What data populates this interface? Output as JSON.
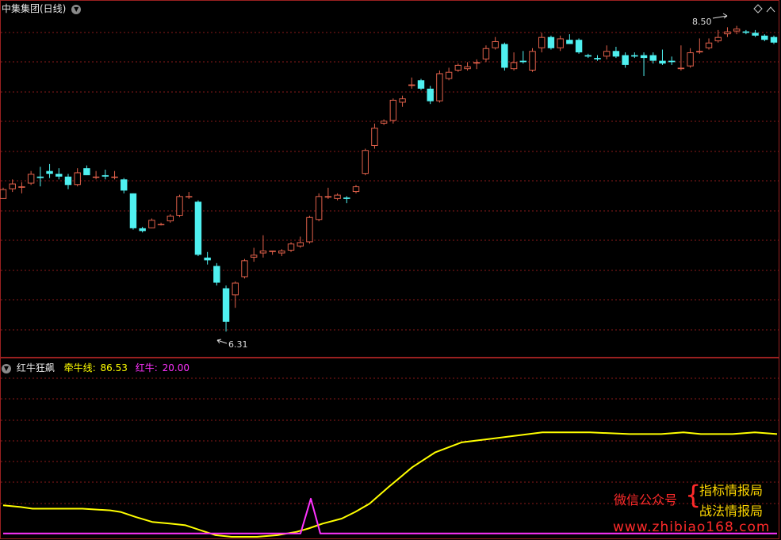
{
  "upper_header": {
    "title": "中集集团(日线)",
    "icon": "chevron-down-icon"
  },
  "upper_chart": {
    "high_label": "8.50",
    "low_label": "6.31"
  },
  "lower_header": {
    "name": "红牛狂飙",
    "line1_label": "牵牛线:",
    "line1_value": "86.53",
    "line2_label": "红牛:",
    "line2_value": "20.00"
  },
  "watermark": {
    "left": "微信公众号",
    "brace": "{",
    "right_top": "指标情报局",
    "right_bottom": "战法情报局",
    "url": "www.zhibiao168.com"
  },
  "colors": {
    "background": "#000000",
    "up": "#e0604a",
    "down": "#4ff0f0",
    "grid": "#8a1a1a",
    "border": "#9a2020",
    "line1": "#ffff00",
    "line2": "#ff33ff",
    "watermark_red": "#ff2a2a",
    "watermark_yellow": "#ffd800"
  },
  "chart_data": [
    {
      "type": "candlestick",
      "title": "中集集团(日线)",
      "annotations": [
        {
          "text": "8.50",
          "at": "high"
        },
        {
          "text": "6.31",
          "at": "low"
        }
      ],
      "ylim": [
        6.2,
        8.62
      ],
      "candles": [
        [
          7.28,
          7.36,
          7.28,
          7.35
        ],
        [
          7.35,
          7.42,
          7.33,
          7.39
        ],
        [
          7.36,
          7.4,
          7.32,
          7.37
        ],
        [
          7.39,
          7.48,
          7.38,
          7.46
        ],
        [
          7.44,
          7.51,
          7.37,
          7.43
        ],
        [
          7.48,
          7.53,
          7.43,
          7.46
        ],
        [
          7.46,
          7.5,
          7.42,
          7.44
        ],
        [
          7.44,
          7.46,
          7.35,
          7.38
        ],
        [
          7.38,
          7.5,
          7.37,
          7.47
        ],
        [
          7.5,
          7.52,
          7.45,
          7.45
        ],
        [
          7.44,
          7.48,
          7.42,
          7.44
        ],
        [
          7.45,
          7.49,
          7.42,
          7.44
        ],
        [
          7.44,
          7.48,
          7.42,
          7.44
        ],
        [
          7.42,
          7.43,
          7.32,
          7.34
        ],
        [
          7.32,
          7.32,
          7.06,
          7.07
        ],
        [
          7.07,
          7.08,
          7.04,
          7.05
        ],
        [
          7.07,
          7.14,
          7.07,
          7.13
        ],
        [
          7.1,
          7.11,
          7.09,
          7.1
        ],
        [
          7.12,
          7.17,
          7.11,
          7.16
        ],
        [
          7.16,
          7.31,
          7.15,
          7.3
        ],
        [
          7.3,
          7.33,
          7.28,
          7.3
        ],
        [
          7.26,
          7.27,
          6.87,
          6.88
        ],
        [
          6.86,
          6.9,
          6.81,
          6.84
        ],
        [
          6.8,
          6.82,
          6.66,
          6.68
        ],
        [
          6.64,
          6.66,
          6.33,
          6.4
        ],
        [
          6.59,
          6.69,
          6.5,
          6.68
        ],
        [
          6.72,
          6.85,
          6.71,
          6.84
        ],
        [
          6.86,
          6.93,
          6.83,
          6.88
        ],
        [
          6.89,
          7.02,
          6.86,
          6.91
        ],
        [
          6.9,
          6.91,
          6.88,
          6.91
        ],
        [
          6.89,
          6.92,
          6.87,
          6.91
        ],
        [
          6.91,
          6.97,
          6.9,
          6.96
        ],
        [
          6.94,
          7.01,
          6.93,
          6.97
        ],
        [
          6.97,
          7.16,
          6.96,
          7.15
        ],
        [
          7.13,
          7.32,
          7.12,
          7.3
        ],
        [
          7.29,
          7.36,
          7.28,
          7.3
        ],
        [
          7.28,
          7.32,
          7.27,
          7.31
        ],
        [
          7.29,
          7.3,
          7.25,
          7.28
        ],
        [
          7.33,
          7.38,
          7.32,
          7.37
        ],
        [
          7.46,
          7.64,
          7.45,
          7.63
        ],
        [
          7.66,
          7.82,
          7.64,
          7.79
        ],
        [
          7.82,
          7.85,
          7.81,
          7.84
        ],
        [
          7.84,
          8.0,
          7.82,
          7.99
        ],
        [
          7.97,
          8.02,
          7.94,
          8.0
        ],
        [
          8.09,
          8.15,
          8.07,
          8.1
        ],
        [
          8.13,
          8.14,
          8.06,
          8.07
        ],
        [
          8.07,
          8.09,
          7.96,
          7.98
        ],
        [
          7.98,
          8.2,
          7.97,
          8.18
        ],
        [
          8.14,
          8.22,
          8.13,
          8.19
        ],
        [
          8.2,
          8.25,
          8.19,
          8.24
        ],
        [
          8.21,
          8.26,
          8.2,
          8.23
        ],
        [
          8.25,
          8.28,
          8.21,
          8.26
        ],
        [
          8.28,
          8.38,
          8.26,
          8.36
        ],
        [
          8.36,
          8.44,
          8.35,
          8.41
        ],
        [
          8.39,
          8.4,
          8.2,
          8.22
        ],
        [
          8.21,
          8.33,
          8.2,
          8.26
        ],
        [
          8.27,
          8.34,
          8.25,
          8.26
        ],
        [
          8.2,
          8.36,
          8.19,
          8.34
        ],
        [
          8.36,
          8.47,
          8.33,
          8.44
        ],
        [
          8.44,
          8.45,
          8.35,
          8.36
        ],
        [
          8.36,
          8.45,
          8.34,
          8.43
        ],
        [
          8.42,
          8.46,
          8.39,
          8.39
        ],
        [
          8.42,
          8.43,
          8.32,
          8.33
        ],
        [
          8.31,
          8.32,
          8.29,
          8.3
        ],
        [
          8.29,
          8.31,
          8.27,
          8.28
        ],
        [
          8.3,
          8.38,
          8.28,
          8.34
        ],
        [
          8.34,
          8.37,
          8.29,
          8.3
        ],
        [
          8.31,
          8.33,
          8.22,
          8.24
        ],
        [
          8.31,
          8.33,
          8.29,
          8.3
        ],
        [
          8.31,
          8.33,
          8.16,
          8.29
        ],
        [
          8.31,
          8.33,
          8.25,
          8.27
        ],
        [
          8.27,
          8.35,
          8.24,
          8.25
        ],
        [
          8.27,
          8.3,
          8.24,
          8.26
        ],
        [
          8.21,
          8.38,
          8.2,
          8.22
        ],
        [
          8.23,
          8.36,
          8.22,
          8.33
        ],
        [
          8.33,
          8.43,
          8.32,
          8.34
        ],
        [
          8.36,
          8.43,
          8.35,
          8.4
        ],
        [
          8.41,
          8.49,
          8.4,
          8.44
        ],
        [
          8.46,
          8.51,
          8.44,
          8.48
        ],
        [
          8.48,
          8.52,
          8.46,
          8.5
        ],
        [
          8.48,
          8.49,
          8.46,
          8.47
        ],
        [
          8.47,
          8.49,
          8.44,
          8.45
        ],
        [
          8.45,
          8.46,
          8.41,
          8.42
        ],
        [
          8.44,
          8.45,
          8.39,
          8.4
        ]
      ]
    },
    {
      "type": "line",
      "title": "红牛狂飙",
      "ylim": [
        0,
        100
      ],
      "series": [
        {
          "name": "牵牛线",
          "last": 86.53,
          "x": [
            0,
            22,
            37,
            62,
            81,
            100,
            135,
            148,
            167,
            188,
            210,
            230,
            255,
            268,
            288,
            320,
            346,
            370,
            385,
            403,
            427,
            444,
            462,
            486,
            516,
            545,
            578,
            612,
            646,
            680,
            700,
            740,
            790,
            830,
            858,
            880,
            920,
            948,
            976
          ],
          "values": [
            19,
            18,
            17,
            17,
            17,
            17,
            16,
            15,
            12,
            9,
            8,
            7,
            3,
            1,
            0,
            0,
            1,
            3,
            5,
            8,
            11,
            15,
            20,
            30,
            42,
            51,
            57,
            59,
            61,
            63,
            63,
            63,
            62,
            62,
            63,
            62,
            62,
            63,
            62
          ]
        },
        {
          "name": "红牛",
          "last": 20.0,
          "x": [
            0,
            375,
            388,
            400,
            976
          ],
          "values": [
            2,
            2,
            23,
            2,
            2
          ]
        }
      ]
    }
  ]
}
